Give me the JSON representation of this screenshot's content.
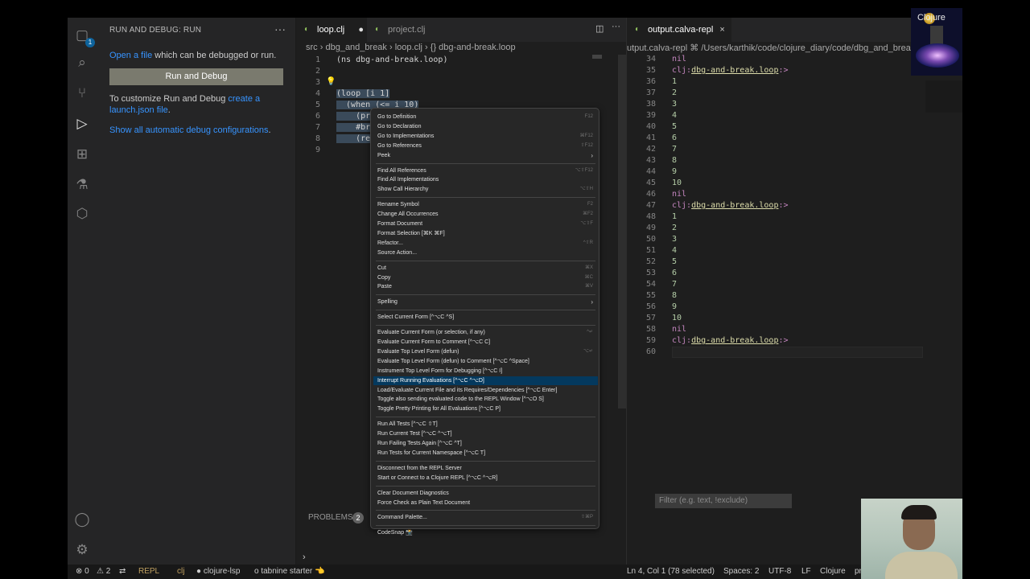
{
  "activity_bar": {
    "explorer_badge": "1"
  },
  "sidebar": {
    "title": "RUN AND DEBUG: RUN",
    "more_label": "···",
    "open_file_link": "Open a file",
    "open_file_rest": " which can be debugged or run.",
    "run_debug_button": "Run and Debug",
    "customize_text": "To customize Run and Debug ",
    "create_launch_link": "create a launch.json file",
    "customize_end": ".",
    "show_configs_link": "Show all automatic debug configurations",
    "show_configs_end": "."
  },
  "editor": {
    "tabs": [
      {
        "label": "loop.clj",
        "modified": "●"
      },
      {
        "label": "project.clj",
        "close": "×"
      }
    ],
    "breadcrumb": {
      "part1": "src",
      "sep": "›",
      "part2": "dbg_and_break",
      "part3": "loop.clj",
      "part4": "{} dbg-and-break.loop"
    },
    "line_numbers": [
      "1",
      "2",
      "3",
      "4",
      "5",
      "6",
      "7",
      "8",
      "9"
    ],
    "code_lines": [
      "(ns dbg-and-break.loop)",
      "",
      "",
      "(loop [i 1]",
      "  (when (<= i 10)",
      "    (pr",
      "    #bre",
      "    (rec",
      ""
    ]
  },
  "panel": {
    "problems_label": "PROBLEMS",
    "problems_count": "2",
    "prompt": "›"
  },
  "output": {
    "tab_label": "output.calva-repl",
    "tab_close": "×",
    "breadcrumb": "utput.calva-repl  ⌘ /Users/karthik/code/clojure_diary/code/dbg_and_break",
    "filter_placeholder": "Filter (e.g. text, !exclude)",
    "line_numbers": [
      "34",
      "35",
      "36",
      "37",
      "38",
      "39",
      "40",
      "41",
      "42",
      "43",
      "44",
      "45",
      "46",
      "47",
      "48",
      "49",
      "50",
      "51",
      "52",
      "53",
      "54",
      "55",
      "56",
      "57",
      "58",
      "59",
      "60"
    ],
    "lines": [
      {
        "kind": "nil",
        "text": "nil"
      },
      {
        "kind": "prompt",
        "prefix": "clj:",
        "ns": "dbg-and-break.loop",
        "arrow": ":>"
      },
      {
        "kind": "num",
        "text": "1"
      },
      {
        "kind": "num",
        "text": "2"
      },
      {
        "kind": "num",
        "text": "3"
      },
      {
        "kind": "num",
        "text": "4"
      },
      {
        "kind": "num",
        "text": "5"
      },
      {
        "kind": "num",
        "text": "6"
      },
      {
        "kind": "num",
        "text": "7"
      },
      {
        "kind": "num",
        "text": "8"
      },
      {
        "kind": "num",
        "text": "9"
      },
      {
        "kind": "num",
        "text": "10"
      },
      {
        "kind": "nil",
        "text": "nil"
      },
      {
        "kind": "prompt",
        "prefix": "clj:",
        "ns": "dbg-and-break.loop",
        "arrow": ":>"
      },
      {
        "kind": "num",
        "text": "1"
      },
      {
        "kind": "num",
        "text": "2"
      },
      {
        "kind": "num",
        "text": "3"
      },
      {
        "kind": "num",
        "text": "4"
      },
      {
        "kind": "num",
        "text": "5"
      },
      {
        "kind": "num",
        "text": "6"
      },
      {
        "kind": "num",
        "text": "7"
      },
      {
        "kind": "num",
        "text": "8"
      },
      {
        "kind": "num",
        "text": "9"
      },
      {
        "kind": "num",
        "text": "10"
      },
      {
        "kind": "nil",
        "text": "nil"
      },
      {
        "kind": "prompt",
        "prefix": "clj:",
        "ns": "dbg-and-break.loop",
        "arrow": ":>"
      },
      {
        "kind": "empty",
        "text": ""
      }
    ]
  },
  "context_menu": {
    "groups": [
      [
        {
          "label": "Go to Definition",
          "shortcut": "F12"
        },
        {
          "label": "Go to Declaration",
          "shortcut": ""
        },
        {
          "label": "Go to Implementations",
          "shortcut": "⌘F12"
        },
        {
          "label": "Go to References",
          "shortcut": "⇧F12"
        },
        {
          "label": "Peek",
          "shortcut": "",
          "submenu": "›"
        }
      ],
      [
        {
          "label": "Find All References",
          "shortcut": "⌥⇧F12"
        },
        {
          "label": "Find All Implementations",
          "shortcut": ""
        },
        {
          "label": "Show Call Hierarchy",
          "shortcut": "⌥⇧H"
        }
      ],
      [
        {
          "label": "Rename Symbol",
          "shortcut": "F2"
        },
        {
          "label": "Change All Occurrences",
          "shortcut": "⌘F2"
        },
        {
          "label": "Format Document",
          "shortcut": "⌥⇧F"
        },
        {
          "label": "Format Selection [⌘K ⌘F]",
          "shortcut": ""
        },
        {
          "label": "Refactor...",
          "shortcut": "^⇧R"
        },
        {
          "label": "Source Action...",
          "shortcut": ""
        }
      ],
      [
        {
          "label": "Cut",
          "shortcut": "⌘X"
        },
        {
          "label": "Copy",
          "shortcut": "⌘C"
        },
        {
          "label": "Paste",
          "shortcut": "⌘V"
        }
      ],
      [
        {
          "label": "Spelling",
          "shortcut": "",
          "submenu": "›"
        }
      ],
      [
        {
          "label": "Select Current Form [^⌥C ^S]",
          "shortcut": ""
        }
      ],
      [
        {
          "label": "Evaluate Current Form  (or selection, if any)",
          "shortcut": "^↵"
        },
        {
          "label": "Evaluate Current Form to Comment [^⌥C C]",
          "shortcut": ""
        },
        {
          "label": "Evaluate Top Level Form (defun)",
          "shortcut": "⌥↵"
        },
        {
          "label": "Evaluate Top Level Form (defun) to Comment [^⌥C ^Space]",
          "shortcut": ""
        },
        {
          "label": "Instrument Top Level Form for Debugging [^⌥C I]",
          "shortcut": ""
        },
        {
          "label": "Interrupt Running Evaluations [^⌥C ^⌥D]",
          "shortcut": "",
          "highlighted": true
        },
        {
          "label": "Load/Evaluate Current File and its Requires/Dependencies [^⌥C Enter]",
          "shortcut": ""
        },
        {
          "label": "Toggle also sending evaluated code to the REPL Window [^⌥O S]",
          "shortcut": ""
        },
        {
          "label": "Toggle Pretty Printing for All Evaluations [^⌥C P]",
          "shortcut": ""
        }
      ],
      [
        {
          "label": "Run All Tests [^⌥C ⇧T]",
          "shortcut": ""
        },
        {
          "label": "Run Current Test [^⌥C ^⌥T]",
          "shortcut": ""
        },
        {
          "label": "Run Failing Tests Again [^⌥C ^T]",
          "shortcut": ""
        },
        {
          "label": "Run Tests for Current Namespace [^⌥C T]",
          "shortcut": ""
        }
      ],
      [
        {
          "label": "Disconnect from the REPL Server",
          "shortcut": ""
        },
        {
          "label": "Start or Connect to a Clojure REPL [^⌥C ^⌥R]",
          "shortcut": ""
        }
      ],
      [
        {
          "label": "Clear Document Diagnostics",
          "shortcut": ""
        },
        {
          "label": "Force Check as Plain Text Document",
          "shortcut": ""
        }
      ],
      [
        {
          "label": "Command Palette...",
          "shortcut": "⇧⌘P"
        }
      ],
      [
        {
          "label": "CodeSnap 📸",
          "shortcut": ""
        }
      ]
    ]
  },
  "status_bar": {
    "errors": "⊗ 0",
    "warnings": "⚠ 2",
    "repl": "REPL",
    "lang_short": "clj",
    "lsp": "● clojure-lsp",
    "tabnine": "o tabnine starter 👈",
    "cursor": "Ln 4, Col 1 (78 selected)",
    "spaces": "Spaces: 2",
    "encoding": "UTF-8",
    "eol": "LF",
    "language": "Clojure",
    "extra": "pr"
  },
  "overlay": {
    "logo_text": "Clojure"
  }
}
